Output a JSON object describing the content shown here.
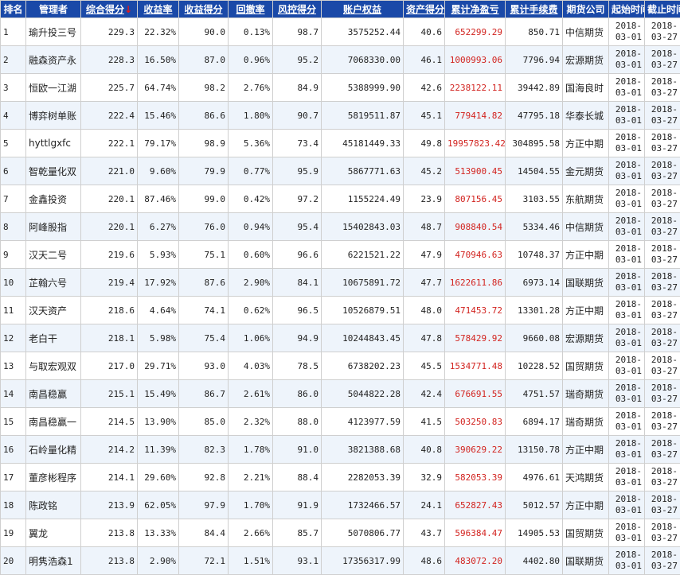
{
  "headers": [
    "排名",
    "管理者",
    "综合得分",
    "收益率",
    "收益得分",
    "回撤率",
    "风控得分",
    "账户权益",
    "资产得分",
    "累计净盈亏",
    "累计手续费",
    "期货公司",
    "起始时间",
    "截止时间"
  ],
  "sort_arrow": "↓",
  "rows": [
    {
      "rank": "1",
      "name": "瑜升投三号",
      "score": "229.3",
      "ret": "22.32%",
      "ret_score": "90.0",
      "dd": "0.13%",
      "risk": "98.7",
      "equity": "3575252.44",
      "asset": "40.6",
      "pnl": "652299.29",
      "fee": "850.71",
      "company": "中信期货",
      "start": "2018-03-01",
      "end": "2018-03-27"
    },
    {
      "rank": "2",
      "name": "融森资产永",
      "score": "228.3",
      "ret": "16.50%",
      "ret_score": "87.0",
      "dd": "0.96%",
      "risk": "95.2",
      "equity": "7068330.00",
      "asset": "46.1",
      "pnl": "1000993.06",
      "fee": "7796.94",
      "company": "宏源期货",
      "start": "2018-03-01",
      "end": "2018-03-27"
    },
    {
      "rank": "3",
      "name": "恒欧一江湖",
      "score": "225.7",
      "ret": "64.74%",
      "ret_score": "98.2",
      "dd": "2.76%",
      "risk": "84.9",
      "equity": "5388999.90",
      "asset": "42.6",
      "pnl": "2238122.11",
      "fee": "39442.89",
      "company": "国海良时",
      "start": "2018-03-01",
      "end": "2018-03-27"
    },
    {
      "rank": "4",
      "name": "博弈树单账",
      "score": "222.4",
      "ret": "15.46%",
      "ret_score": "86.6",
      "dd": "1.80%",
      "risk": "90.7",
      "equity": "5819511.87",
      "asset": "45.1",
      "pnl": "779414.82",
      "fee": "47795.18",
      "company": "华泰长城",
      "start": "2018-03-01",
      "end": "2018-03-27"
    },
    {
      "rank": "5",
      "name": "hyttlgxfc",
      "score": "222.1",
      "ret": "79.17%",
      "ret_score": "98.9",
      "dd": "5.36%",
      "risk": "73.4",
      "equity": "45181449.33",
      "asset": "49.8",
      "pnl": "19957823.42",
      "fee": "304895.58",
      "company": "方正中期",
      "start": "2018-03-01",
      "end": "2018-03-27"
    },
    {
      "rank": "6",
      "name": "智乾量化双",
      "score": "221.0",
      "ret": "9.60%",
      "ret_score": "79.9",
      "dd": "0.77%",
      "risk": "95.9",
      "equity": "5867771.63",
      "asset": "45.2",
      "pnl": "513900.45",
      "fee": "14504.55",
      "company": "金元期货",
      "start": "2018-03-01",
      "end": "2018-03-27"
    },
    {
      "rank": "7",
      "name": "金鑫投资",
      "score": "220.1",
      "ret": "87.46%",
      "ret_score": "99.0",
      "dd": "0.42%",
      "risk": "97.2",
      "equity": "1155224.49",
      "asset": "23.9",
      "pnl": "807156.45",
      "fee": "3103.55",
      "company": "东航期货",
      "start": "2018-03-01",
      "end": "2018-03-27"
    },
    {
      "rank": "8",
      "name": "阿峰股指",
      "score": "220.1",
      "ret": "6.27%",
      "ret_score": "76.0",
      "dd": "0.94%",
      "risk": "95.4",
      "equity": "15402843.03",
      "asset": "48.7",
      "pnl": "908840.54",
      "fee": "5334.46",
      "company": "中信期货",
      "start": "2018-03-01",
      "end": "2018-03-27"
    },
    {
      "rank": "9",
      "name": "汉天二号",
      "score": "219.6",
      "ret": "5.93%",
      "ret_score": "75.1",
      "dd": "0.60%",
      "risk": "96.6",
      "equity": "6221521.22",
      "asset": "47.9",
      "pnl": "470946.63",
      "fee": "10748.37",
      "company": "方正中期",
      "start": "2018-03-01",
      "end": "2018-03-27"
    },
    {
      "rank": "10",
      "name": "芷翰六号",
      "score": "219.4",
      "ret": "17.92%",
      "ret_score": "87.6",
      "dd": "2.90%",
      "risk": "84.1",
      "equity": "10675891.72",
      "asset": "47.7",
      "pnl": "1622611.86",
      "fee": "6973.14",
      "company": "国联期货",
      "start": "2018-03-01",
      "end": "2018-03-27"
    },
    {
      "rank": "11",
      "name": "汉天资产",
      "score": "218.6",
      "ret": "4.64%",
      "ret_score": "74.1",
      "dd": "0.62%",
      "risk": "96.5",
      "equity": "10526879.51",
      "asset": "48.0",
      "pnl": "471453.72",
      "fee": "13301.28",
      "company": "方正中期",
      "start": "2018-03-01",
      "end": "2018-03-27"
    },
    {
      "rank": "12",
      "name": "老白干",
      "score": "218.1",
      "ret": "5.98%",
      "ret_score": "75.4",
      "dd": "1.06%",
      "risk": "94.9",
      "equity": "10244843.45",
      "asset": "47.8",
      "pnl": "578429.92",
      "fee": "9660.08",
      "company": "宏源期货",
      "start": "2018-03-01",
      "end": "2018-03-27"
    },
    {
      "rank": "13",
      "name": "与取宏观双",
      "score": "217.0",
      "ret": "29.71%",
      "ret_score": "93.0",
      "dd": "4.03%",
      "risk": "78.5",
      "equity": "6738202.23",
      "asset": "45.5",
      "pnl": "1534771.48",
      "fee": "10228.52",
      "company": "国贸期货",
      "start": "2018-03-01",
      "end": "2018-03-27"
    },
    {
      "rank": "14",
      "name": "南昌稳赢",
      "score": "215.1",
      "ret": "15.49%",
      "ret_score": "86.7",
      "dd": "2.61%",
      "risk": "86.0",
      "equity": "5044822.28",
      "asset": "42.4",
      "pnl": "676691.55",
      "fee": "4751.57",
      "company": "瑞奇期货",
      "start": "2018-03-01",
      "end": "2018-03-27"
    },
    {
      "rank": "15",
      "name": "南昌稳赢一",
      "score": "214.5",
      "ret": "13.90%",
      "ret_score": "85.0",
      "dd": "2.32%",
      "risk": "88.0",
      "equity": "4123977.59",
      "asset": "41.5",
      "pnl": "503250.83",
      "fee": "6894.17",
      "company": "瑞奇期货",
      "start": "2018-03-01",
      "end": "2018-03-27"
    },
    {
      "rank": "16",
      "name": "石岭量化精",
      "score": "214.2",
      "ret": "11.39%",
      "ret_score": "82.3",
      "dd": "1.78%",
      "risk": "91.0",
      "equity": "3821388.68",
      "asset": "40.8",
      "pnl": "390629.22",
      "fee": "13150.78",
      "company": "方正中期",
      "start": "2018-03-01",
      "end": "2018-03-27"
    },
    {
      "rank": "17",
      "name": "董彦彬程序",
      "score": "214.1",
      "ret": "29.60%",
      "ret_score": "92.8",
      "dd": "2.21%",
      "risk": "88.4",
      "equity": "2282053.39",
      "asset": "32.9",
      "pnl": "582053.39",
      "fee": "4976.61",
      "company": "天鸿期货",
      "start": "2018-03-01",
      "end": "2018-03-27"
    },
    {
      "rank": "18",
      "name": "陈政铭",
      "score": "213.9",
      "ret": "62.05%",
      "ret_score": "97.9",
      "dd": "1.70%",
      "risk": "91.9",
      "equity": "1732466.57",
      "asset": "24.1",
      "pnl": "652827.43",
      "fee": "5012.57",
      "company": "方正中期",
      "start": "2018-03-01",
      "end": "2018-03-27"
    },
    {
      "rank": "19",
      "name": "翼龙",
      "score": "213.8",
      "ret": "13.33%",
      "ret_score": "84.4",
      "dd": "2.66%",
      "risk": "85.7",
      "equity": "5070806.77",
      "asset": "43.7",
      "pnl": "596384.47",
      "fee": "14905.53",
      "company": "国贸期货",
      "start": "2018-03-01",
      "end": "2018-03-27"
    },
    {
      "rank": "20",
      "name": "明隽浩森1",
      "score": "213.8",
      "ret": "2.90%",
      "ret_score": "72.1",
      "dd": "1.51%",
      "risk": "93.1",
      "equity": "17356317.99",
      "asset": "48.6",
      "pnl": "483072.20",
      "fee": "4402.80",
      "company": "国联期货",
      "start": "2018-03-01",
      "end": "2018-03-27"
    }
  ]
}
